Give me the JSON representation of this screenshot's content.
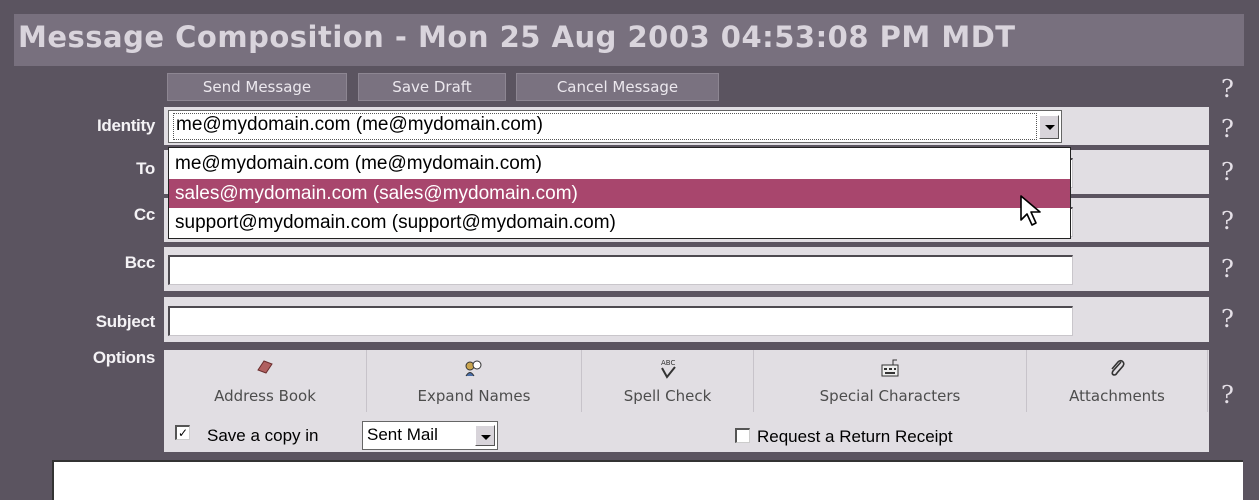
{
  "title": "Message Composition - Mon 25 Aug 2003 04:53:08 PM MDT",
  "toolbar": {
    "send_label": "Send Message",
    "save_draft_label": "Save Draft",
    "cancel_label": "Cancel Message"
  },
  "help_glyph": "?",
  "labels": {
    "identity": "Identity",
    "to": "To",
    "cc": "Cc",
    "bcc": "Bcc",
    "subject": "Subject",
    "options": "Options"
  },
  "identity": {
    "selected": "me@mydomain.com (me@mydomain.com)",
    "options": [
      "me@mydomain.com (me@mydomain.com)",
      "sales@mydomain.com (sales@mydomain.com)",
      "support@mydomain.com (support@mydomain.com)"
    ],
    "highlighted_index": 1,
    "highlight_color": "#a8466d"
  },
  "fields": {
    "to_value": "",
    "cc_value": "",
    "bcc_value": "",
    "subject_value": ""
  },
  "options": {
    "buttons": [
      {
        "label": "Address Book",
        "icon": "address-book-icon"
      },
      {
        "label": "Expand Names",
        "icon": "expand-names-icon"
      },
      {
        "label": "Spell Check",
        "icon": "spell-check-icon"
      },
      {
        "label": "Special Characters",
        "icon": "special-characters-icon"
      },
      {
        "label": "Attachments",
        "icon": "paperclip-icon"
      }
    ],
    "save_copy_label": "Save a copy in",
    "save_copy_checked": true,
    "save_copy_folder": "Sent Mail",
    "return_receipt_label": "Request a Return Receipt",
    "return_receipt_checked": false
  },
  "colors": {
    "background": "#5b5460",
    "title_bar": "#78707e",
    "panel": "#e1dee3"
  }
}
